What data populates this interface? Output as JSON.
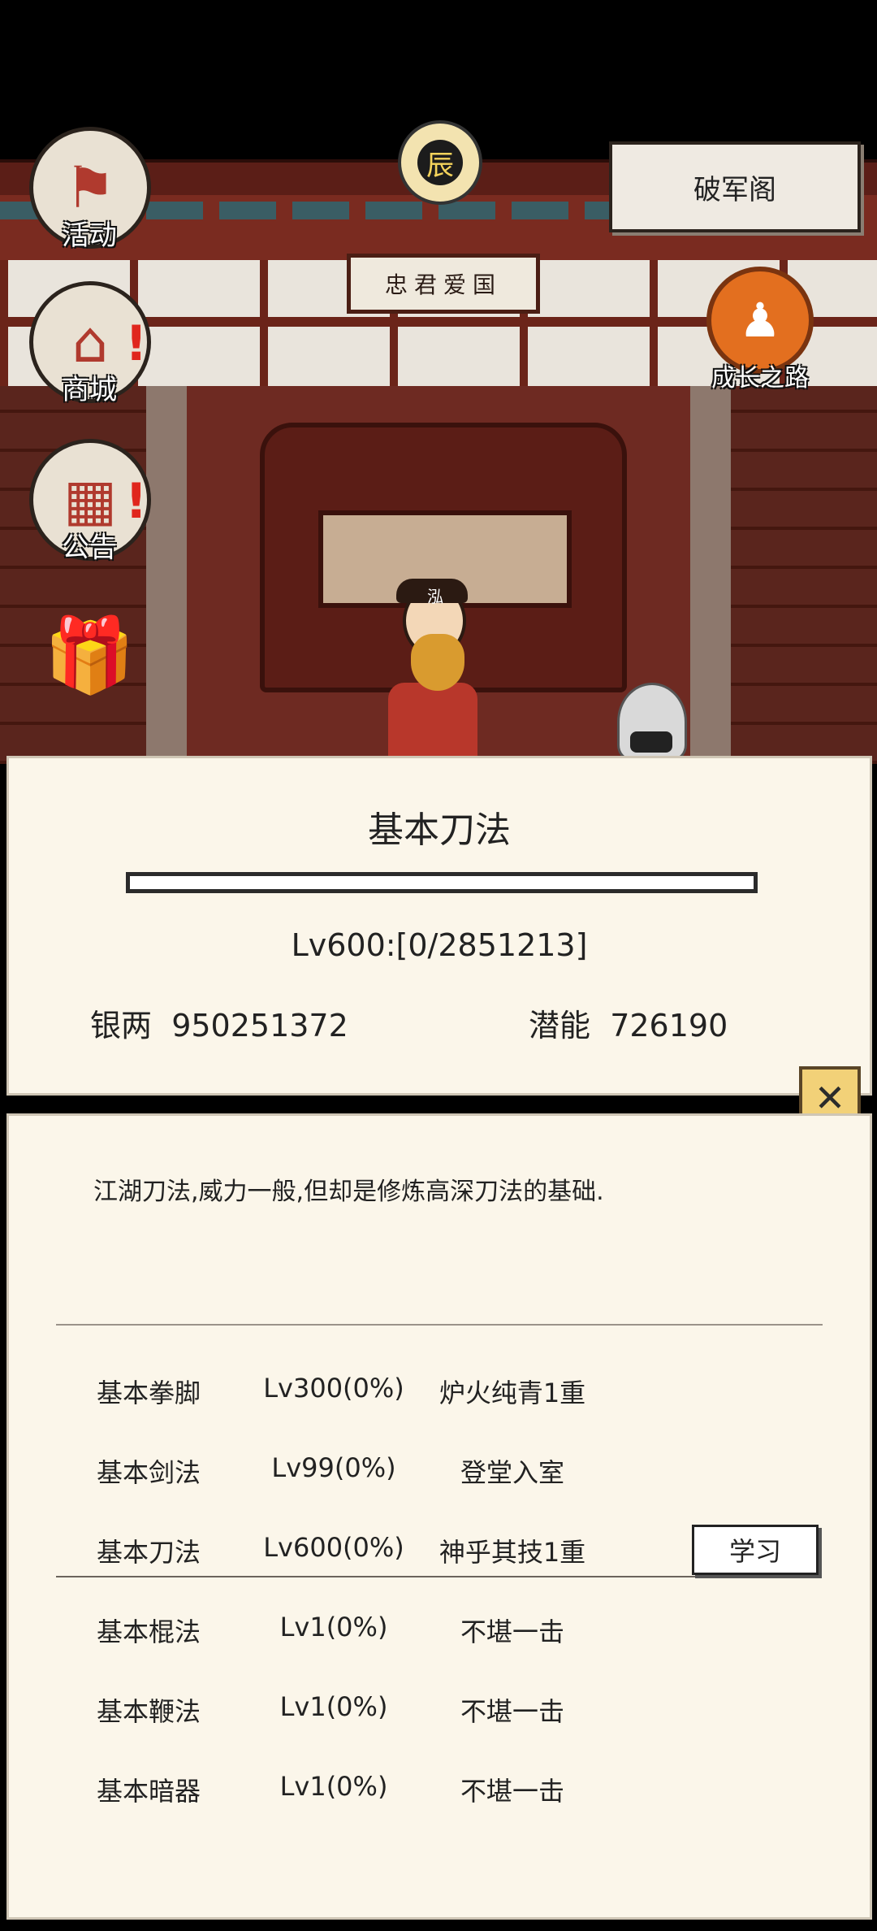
{
  "scene": {
    "plaque_text": "忠君爱国",
    "time_icon_text": "辰",
    "character_name": "泓",
    "location_button": "破军阁",
    "growth_label": "成长之路"
  },
  "left_menu": [
    {
      "label": "活动",
      "icon": "flag-icon",
      "badge": ""
    },
    {
      "label": "商城",
      "icon": "shop-icon",
      "badge": "!"
    },
    {
      "label": "公告",
      "icon": "notice-board-icon",
      "badge": "!"
    },
    {
      "label": "",
      "icon": "gift-icon",
      "badge": ""
    }
  ],
  "skill_panel": {
    "title": "基本刀法",
    "progress_fraction": 0,
    "level_text": "Lv600:[0/2851213]",
    "silver_label": "银两",
    "silver_value": "950251372",
    "potential_label": "潜能",
    "potential_value": "726190",
    "close_icon": "close-icon"
  },
  "detail_panel": {
    "description": "江湖刀法,威力一般,但却是修炼高深刀法的基础.",
    "rows": [
      {
        "name": "基本拳脚",
        "level": "Lv300(0%)",
        "rank": "炉火纯青1重"
      },
      {
        "name": "基本剑法",
        "level": "Lv99(0%)",
        "rank": "登堂入室"
      },
      {
        "name": "基本刀法",
        "level": "Lv600(0%)",
        "rank": "神乎其技1重"
      },
      {
        "name": "基本棍法",
        "level": "Lv1(0%)",
        "rank": "不堪一击"
      },
      {
        "name": "基本鞭法",
        "level": "Lv1(0%)",
        "rank": "不堪一击"
      },
      {
        "name": "基本暗器",
        "level": "Lv1(0%)",
        "rank": "不堪一击"
      }
    ],
    "learn_button": "学习"
  }
}
